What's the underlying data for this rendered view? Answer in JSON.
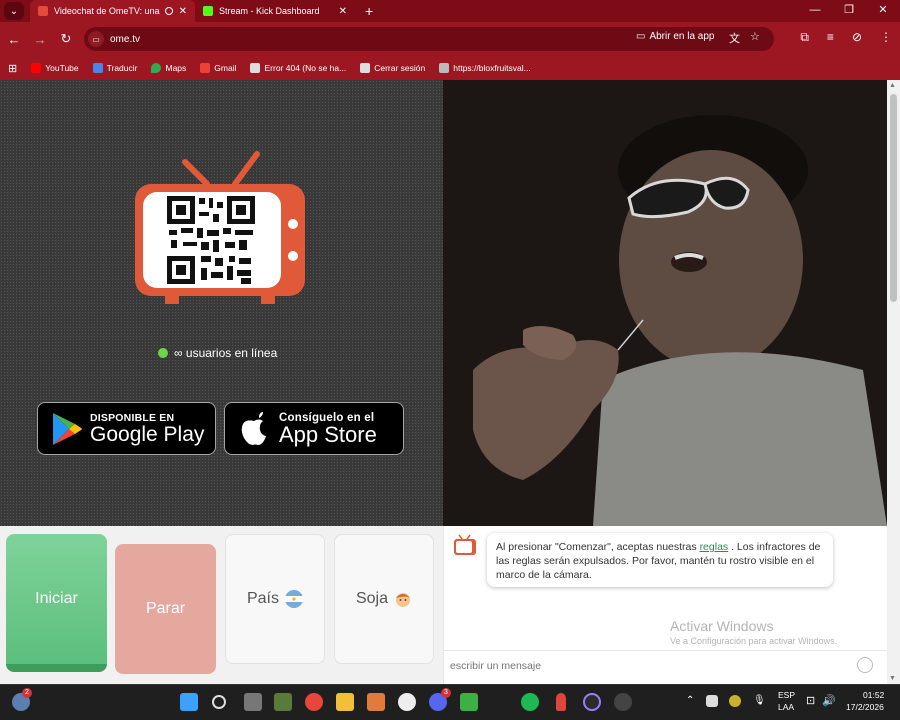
{
  "browser": {
    "tabs": [
      {
        "title": "Videochat de OmeTV: una a",
        "active": true
      },
      {
        "title": "Stream - Kick Dashboard",
        "active": false
      }
    ],
    "new_tab": "+",
    "url": "ome.tv",
    "open_in_app": "Abrir en la app",
    "accent_color": "#9d1723"
  },
  "bookmarks": [
    {
      "label": "YouTube",
      "icon": "youtube-icon"
    },
    {
      "label": "Traducir",
      "icon": "translate-icon"
    },
    {
      "label": "Maps",
      "icon": "maps-icon"
    },
    {
      "label": "Gmail",
      "icon": "gmail-icon"
    },
    {
      "label": "Error 404 (No se ha...",
      "icon": "page-icon"
    },
    {
      "label": "Cerrar sesión",
      "icon": "page-icon"
    },
    {
      "label": "https://bloxfruitsval...",
      "icon": "link-icon"
    }
  ],
  "left": {
    "online_text": "∞ usuarios en línea",
    "google_play": {
      "small": "DISPONIBLE EN",
      "big": "Google Play"
    },
    "app_store": {
      "small": "Consíguelo en el",
      "big": "App Store"
    }
  },
  "controls": {
    "start": "Iniciar",
    "stop": "Parar",
    "country": "País",
    "gender": "Soja"
  },
  "chat": {
    "notice_pre": "Al presionar \"Comenzar\", aceptas nuestras",
    "notice_link": "reglas",
    "notice_post": ". Los infractores de las reglas serán expulsados. Por favor, mantén tu rostro visible en el marco de la cámara.",
    "placeholder": "escribir un mensaje",
    "watermark_title": "Activar Windows",
    "watermark_sub": "Ve a Configuración para activar Windows."
  },
  "taskbar": {
    "weather_badge": "2",
    "discord_badge": "3",
    "lang": "ESP",
    "lang2": "LAA",
    "time": "01:52",
    "date": "17/2/2026"
  }
}
